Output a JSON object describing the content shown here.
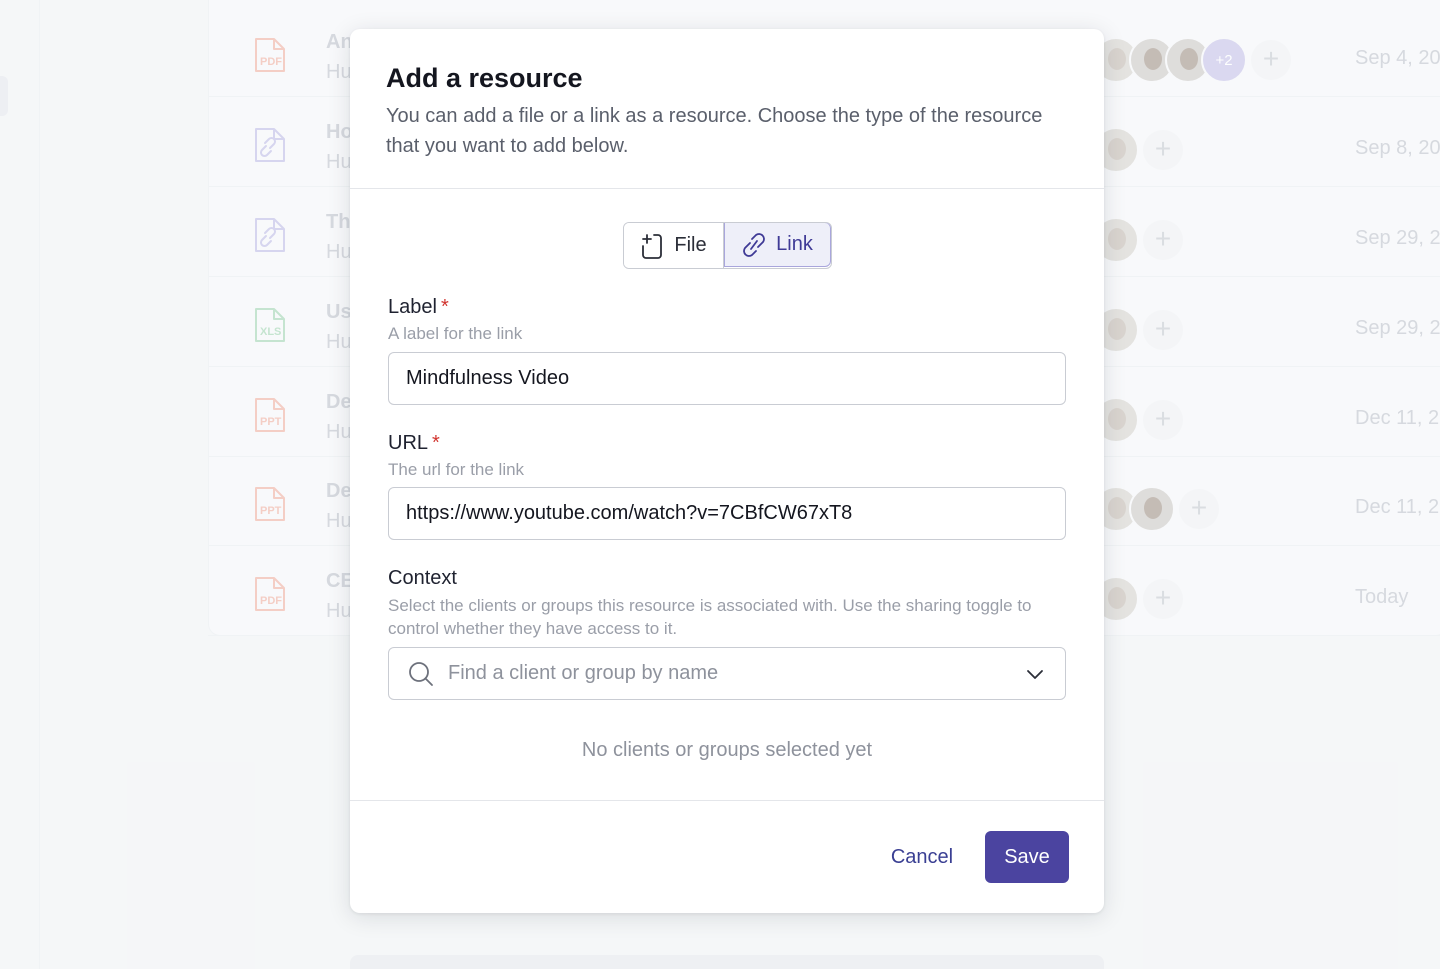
{
  "background": {
    "rows": [
      {
        "title": "An",
        "subtitle": "Hu",
        "type": "PDF",
        "color": "#f2b5a8",
        "date": "Sep 4, 20",
        "avatars": 3,
        "extra": "+2"
      },
      {
        "title": "Ho",
        "subtitle": "Hu",
        "type": "link",
        "color": "#c4c1e8",
        "date": "Sep 8, 20",
        "avatars": 1,
        "extra": ""
      },
      {
        "title": "Th",
        "subtitle": "Hu",
        "type": "link",
        "color": "#c4c1e8",
        "date": "Sep 29, 2",
        "avatars": 1,
        "extra": ""
      },
      {
        "title": "Us",
        "subtitle": "Hu",
        "type": "XLS",
        "color": "#a9d8b8",
        "date": "Sep 29, 2",
        "avatars": 1,
        "extra": ""
      },
      {
        "title": "De",
        "subtitle": "Hu",
        "type": "PPT",
        "color": "#f2b5a8",
        "date": "Dec 11, 2",
        "avatars": 1,
        "extra": ""
      },
      {
        "title": "De",
        "subtitle": "Hu",
        "type": "PPT",
        "color": "#f2b5a8",
        "date": "Dec 11, 2",
        "avatars": 2,
        "extra": ""
      },
      {
        "title": "CE",
        "subtitle": "Hu",
        "type": "PDF",
        "color": "#f2b5a8",
        "date": "Today",
        "avatars": 1,
        "extra": ""
      }
    ]
  },
  "modal": {
    "title": "Add a resource",
    "description": "You can add a file or a link as a resource. Choose the type of the resource that you want to add below.",
    "toggle": {
      "file_label": "File",
      "link_label": "Link",
      "selected": "Link"
    },
    "label_field": {
      "label": "Label",
      "required_mark": "*",
      "help": "A label for the link",
      "value": "Mindfulness Video"
    },
    "url_field": {
      "label": "URL",
      "required_mark": "*",
      "help": "The url for the link",
      "value": "https://www.youtube.com/watch?v=7CBfCW67xT8"
    },
    "context_field": {
      "label": "Context",
      "help": "Select the clients or groups this resource is associated with. Use the sharing toggle to control whether they have access to it.",
      "placeholder": "Find a client or group by name"
    },
    "empty_note": "No clients or groups selected yet",
    "cancel_label": "Cancel",
    "save_label": "Save"
  },
  "colors": {
    "accent": "#4b44a0",
    "required": "#d1342f"
  },
  "icons": {
    "file_toggle": "file-plus-icon",
    "link_toggle": "link-icon",
    "search": "search-icon",
    "dropdown": "chevron-down-icon"
  }
}
